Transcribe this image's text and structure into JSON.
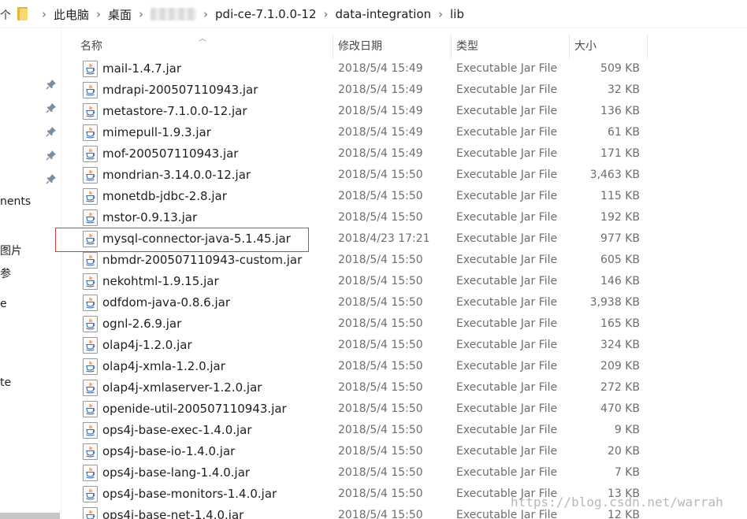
{
  "address": {
    "cut_glyph": "个",
    "crumbs": [
      "此电脑",
      "桌面",
      "",
      "pdi-ce-7.1.0.0-12",
      "data-integration",
      "lib"
    ]
  },
  "nav": {
    "labels": [
      "nents",
      "图片",
      "参",
      "e",
      "te"
    ]
  },
  "columns": {
    "name": "名称",
    "date": "修改日期",
    "type": "类型",
    "size": "大小"
  },
  "files": [
    {
      "name": "mail-1.4.7.jar",
      "date": "2018/5/4 15:49",
      "type": "Executable Jar File",
      "size": "509 KB"
    },
    {
      "name": "mdrapi-200507110943.jar",
      "date": "2018/5/4 15:49",
      "type": "Executable Jar File",
      "size": "32 KB"
    },
    {
      "name": "metastore-7.1.0.0-12.jar",
      "date": "2018/5/4 15:49",
      "type": "Executable Jar File",
      "size": "136 KB"
    },
    {
      "name": "mimepull-1.9.3.jar",
      "date": "2018/5/4 15:49",
      "type": "Executable Jar File",
      "size": "61 KB"
    },
    {
      "name": "mof-200507110943.jar",
      "date": "2018/5/4 15:49",
      "type": "Executable Jar File",
      "size": "171 KB"
    },
    {
      "name": "mondrian-3.14.0.0-12.jar",
      "date": "2018/5/4 15:50",
      "type": "Executable Jar File",
      "size": "3,463 KB"
    },
    {
      "name": "monetdb-jdbc-2.8.jar",
      "date": "2018/5/4 15:50",
      "type": "Executable Jar File",
      "size": "115 KB"
    },
    {
      "name": "mstor-0.9.13.jar",
      "date": "2018/5/4 15:50",
      "type": "Executable Jar File",
      "size": "192 KB"
    },
    {
      "name": "mysql-connector-java-5.1.45.jar",
      "date": "2018/4/23 17:21",
      "type": "Executable Jar File",
      "size": "977 KB"
    },
    {
      "name": "nbmdr-200507110943-custom.jar",
      "date": "2018/5/4 15:50",
      "type": "Executable Jar File",
      "size": "605 KB"
    },
    {
      "name": "nekohtml-1.9.15.jar",
      "date": "2018/5/4 15:50",
      "type": "Executable Jar File",
      "size": "146 KB"
    },
    {
      "name": "odfdom-java-0.8.6.jar",
      "date": "2018/5/4 15:50",
      "type": "Executable Jar File",
      "size": "3,938 KB"
    },
    {
      "name": "ognl-2.6.9.jar",
      "date": "2018/5/4 15:50",
      "type": "Executable Jar File",
      "size": "165 KB"
    },
    {
      "name": "olap4j-1.2.0.jar",
      "date": "2018/5/4 15:50",
      "type": "Executable Jar File",
      "size": "324 KB"
    },
    {
      "name": "olap4j-xmla-1.2.0.jar",
      "date": "2018/5/4 15:50",
      "type": "Executable Jar File",
      "size": "209 KB"
    },
    {
      "name": "olap4j-xmlaserver-1.2.0.jar",
      "date": "2018/5/4 15:50",
      "type": "Executable Jar File",
      "size": "272 KB"
    },
    {
      "name": "openide-util-200507110943.jar",
      "date": "2018/5/4 15:50",
      "type": "Executable Jar File",
      "size": "470 KB"
    },
    {
      "name": "ops4j-base-exec-1.4.0.jar",
      "date": "2018/5/4 15:50",
      "type": "Executable Jar File",
      "size": "9 KB"
    },
    {
      "name": "ops4j-base-io-1.4.0.jar",
      "date": "2018/5/4 15:50",
      "type": "Executable Jar File",
      "size": "20 KB"
    },
    {
      "name": "ops4j-base-lang-1.4.0.jar",
      "date": "2018/5/4 15:50",
      "type": "Executable Jar File",
      "size": "7 KB"
    },
    {
      "name": "ops4j-base-monitors-1.4.0.jar",
      "date": "2018/5/4 15:50",
      "type": "Executable Jar File",
      "size": "13 KB"
    },
    {
      "name": "ops4j-base-net-1.4.0.jar",
      "date": "2018/5/4 15:50",
      "type": "Executable Jar File",
      "size": "12 KB"
    }
  ],
  "watermark": "https://blog.csdn.net/warrah",
  "colors": {
    "highlight": "#d9403a",
    "folder": "#f8d775"
  }
}
